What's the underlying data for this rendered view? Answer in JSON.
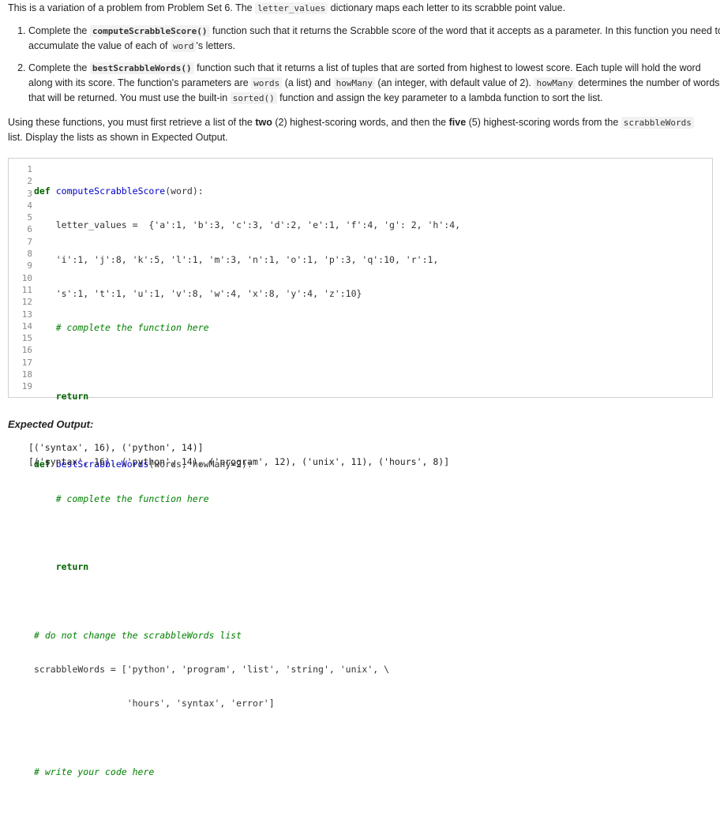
{
  "intro": {
    "before": "This is a variation of a problem from Problem Set 6. The ",
    "code": "letter_values",
    "after": " dictionary maps each letter to its scrabble point value."
  },
  "items": [
    {
      "t1": "Complete the ",
      "c1": "computeScrabbleScore()",
      "t2": " function such that it returns the Scrabble score of the word that it accepts as a parameter. In this function you need to accumulate the value of each of ",
      "c2": "word",
      "t3": "'s letters."
    },
    {
      "t1": "Complete the ",
      "c1": "bestScrabbleWords()",
      "t2": " function such that it returns a list of tuples that are sorted from highest to lowest score. Each tuple will hold the word along with its score. The function's parameters are ",
      "c2": "words",
      "t3": " (a list) and ",
      "c3": "howMany",
      "t4": " (an integer, with default value of 2). ",
      "c4": "howMany",
      "t5": " determines the number of words that will be returned. You must use the built-in ",
      "c5": "sorted()",
      "t6": " function and assign the key parameter to a lambda function to sort the list."
    }
  ],
  "using": {
    "t1": "Using these functions, you must first retrieve a list of the ",
    "b1": "two",
    "t2": " (2) highest-scoring words, and then the ",
    "b2": "five",
    "t3": " (5) highest-scoring words from the ",
    "c1": "scrabbleWords",
    "t4": " list. Display the lists as shown in Expected Output."
  },
  "code_line_numbers": [
    "1",
    "2",
    "3",
    "4",
    "5",
    "6",
    "7",
    "8",
    "9",
    "10",
    "11",
    "12",
    "13",
    "14",
    "15",
    "16",
    "17",
    "18",
    "19"
  ],
  "code": {
    "l1_kw": "def",
    "l1_fn": "computeScrabbleScore",
    "l1_rest": "(word):",
    "l2": "    letter_values =  {'a':1, 'b':3, 'c':3, 'd':2, 'e':1, 'f':4, 'g': 2, 'h':4,",
    "l3": "    'i':1, 'j':8, 'k':5, 'l':1, 'm':3, 'n':1, 'o':1, 'p':3, 'q':10, 'r':1,",
    "l4": "    's':1, 't':1, 'u':1, 'v':8, 'w':4, 'x':8, 'y':4, 'z':10}",
    "l5": "    # complete the function here",
    "l7": "    return",
    "l9_kw": "def",
    "l9_fn": "bestScrabbleWords",
    "l9_rest": "(words, howMany=2):",
    "l10": "    # complete the function here",
    "l12": "    return",
    "l14": "# do not change the scrabbleWords list",
    "l15": "scrabbleWords = ['python', 'program', 'list', 'string', 'unix', \\",
    "l16": "                 'hours', 'syntax', 'error']",
    "l18": "# write your code here"
  },
  "expected": {
    "title": "Expected Output:",
    "lines": [
      "[('syntax', 16), ('python', 14)]",
      "[('syntax', 16), ('python', 14), ('program', 12), ('unix', 11), ('hours', 8)]"
    ]
  }
}
